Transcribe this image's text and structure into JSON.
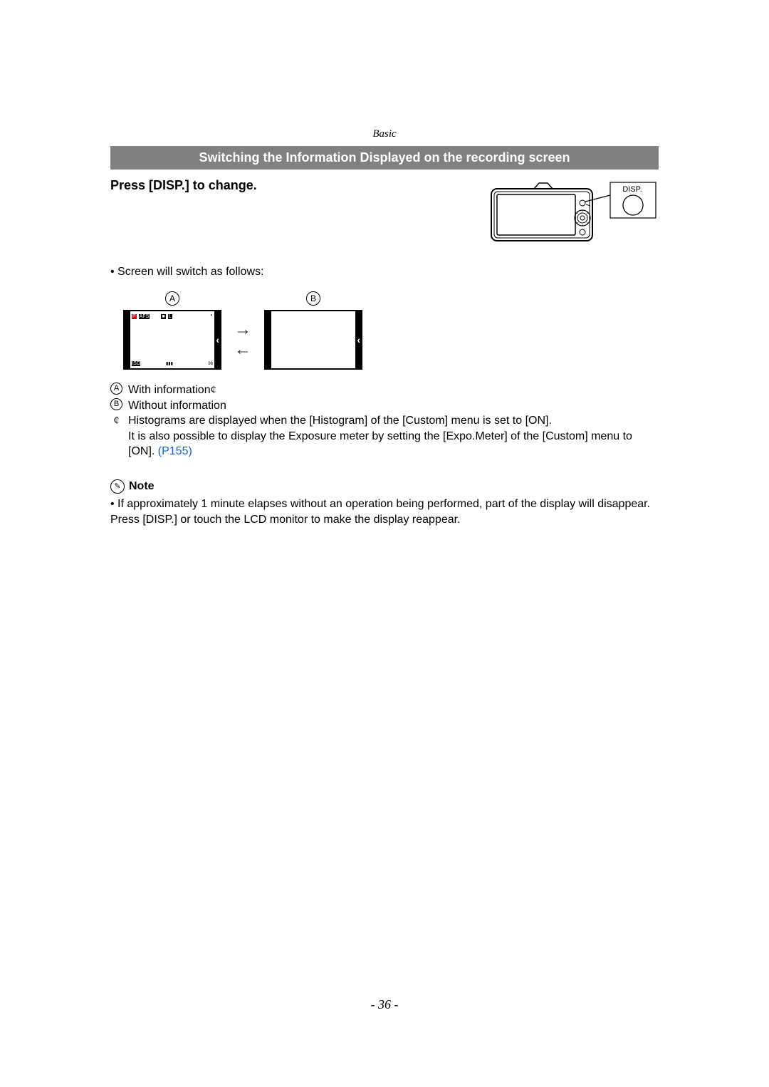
{
  "section_label": "Basic",
  "heading": "Switching the Information Displayed on the recording screen",
  "subheading": "Press [DISP.] to change.",
  "disp_button_label": "DISP.",
  "bullet1": "• Screen will switch as follows:",
  "label_a": "A",
  "label_b": "B",
  "legend": {
    "a_text": "With information",
    "a_marker": "¢",
    "b_text": "Without information",
    "star_marker": "¢",
    "star_text_1": "Histograms are displayed when the [Histogram] of the [Custom] menu is set to [ON].",
    "star_text_2": "It is also possible to display the Exposure meter by setting the [Expo.Meter] of the [Custom] menu to [ON]. ",
    "star_link": "(P155)"
  },
  "note": {
    "label": "Note",
    "text": "• If approximately 1 minute elapses without an operation being performed, part of the display will disappear. Press [DISP.] or touch the LCD monitor to make the display reappear."
  },
  "page_number": "- 36 -"
}
